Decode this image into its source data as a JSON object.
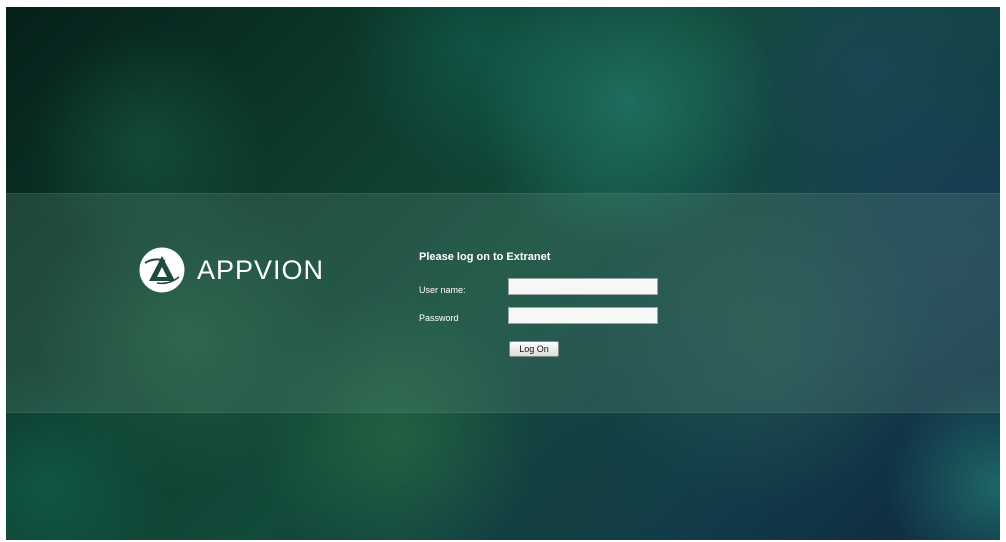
{
  "brand": {
    "name": "APPVION",
    "logo_icon": "appvion-logo-icon"
  },
  "login": {
    "title": "Please log on to Extranet",
    "username_label": "User name:",
    "username_value": "",
    "password_label": "Password",
    "password_value": "",
    "submit_label": "Log On"
  },
  "colors": {
    "background_dark": "#0d3b2d",
    "background_teal": "#2a8c7d",
    "text": "#ffffff"
  }
}
